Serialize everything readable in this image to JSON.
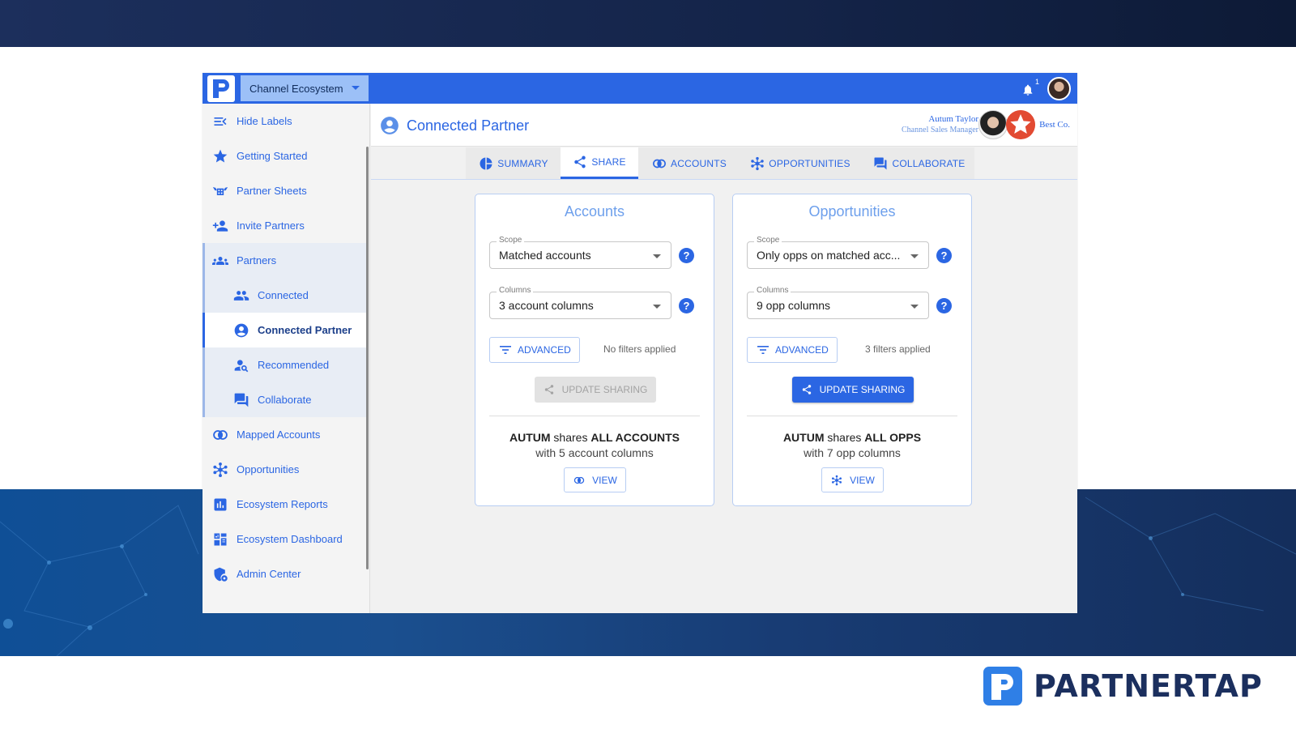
{
  "brand": {
    "name": "PARTNERTAP"
  },
  "topbar": {
    "workspace_select": "Channel Ecosystem",
    "notification_count": "1"
  },
  "sidebar": {
    "items": [
      {
        "label": "Hide Labels",
        "icon": "hide-labels-icon"
      },
      {
        "label": "Getting Started",
        "icon": "star-icon"
      },
      {
        "label": "Partner Sheets",
        "icon": "partner-sheets-icon"
      },
      {
        "label": "Invite Partners",
        "icon": "person-add-icon"
      },
      {
        "label": "Partners",
        "icon": "partners-group-icon"
      },
      {
        "label": "Connected",
        "icon": "people-icon"
      },
      {
        "label": "Connected Partner",
        "icon": "account-circle-icon"
      },
      {
        "label": "Recommended",
        "icon": "person-search-icon"
      },
      {
        "label": "Collaborate",
        "icon": "chat-icon"
      },
      {
        "label": "Mapped Accounts",
        "icon": "mapped-accounts-icon"
      },
      {
        "label": "Opportunities",
        "icon": "opportunities-icon"
      },
      {
        "label": "Ecosystem Reports",
        "icon": "bar-chart-icon"
      },
      {
        "label": "Ecosystem Dashboard",
        "icon": "dashboard-icon"
      },
      {
        "label": "Admin Center",
        "icon": "admin-shield-icon"
      }
    ]
  },
  "header": {
    "title": "Connected Partner",
    "contact_name": "Autum Taylor",
    "contact_role": "Channel Sales Manager",
    "company": "Best Co."
  },
  "tabs": [
    {
      "label": "SUMMARY",
      "icon": "pie-chart-icon"
    },
    {
      "label": "SHARE",
      "icon": "share-icon",
      "active": true
    },
    {
      "label": "ACCOUNTS",
      "icon": "mapped-accounts-icon"
    },
    {
      "label": "OPPORTUNITIES",
      "icon": "opportunities-icon"
    },
    {
      "label": "COLLABORATE",
      "icon": "chat-icon"
    }
  ],
  "accounts_card": {
    "title": "Accounts",
    "scope_label": "Scope",
    "scope_value": "Matched accounts",
    "columns_label": "Columns",
    "columns_value": "3 account columns",
    "advanced": "ADVANCED",
    "filters": "No filters applied",
    "update": "UPDATE SHARING",
    "summary_who": "AUTUM",
    "summary_verb": " shares ",
    "summary_what": "ALL ACCOUNTS",
    "summary_detail": "with 5 account columns",
    "view": "VIEW"
  },
  "opps_card": {
    "title": "Opportunities",
    "scope_label": "Scope",
    "scope_value": "Only opps on matched acc...",
    "columns_label": "Columns",
    "columns_value": "9 opp columns",
    "advanced": "ADVANCED",
    "filters": "3 filters applied",
    "update": "UPDATE SHARING",
    "summary_who": "AUTUM",
    "summary_verb": " shares ",
    "summary_what": "ALL OPPS",
    "summary_detail": "with 7 opp columns",
    "view": "VIEW"
  },
  "help_glyph": "?",
  "colors": {
    "primary": "#2b66e3",
    "topbar": "#2b66e3",
    "brand_navy": "#1b2f5e"
  }
}
